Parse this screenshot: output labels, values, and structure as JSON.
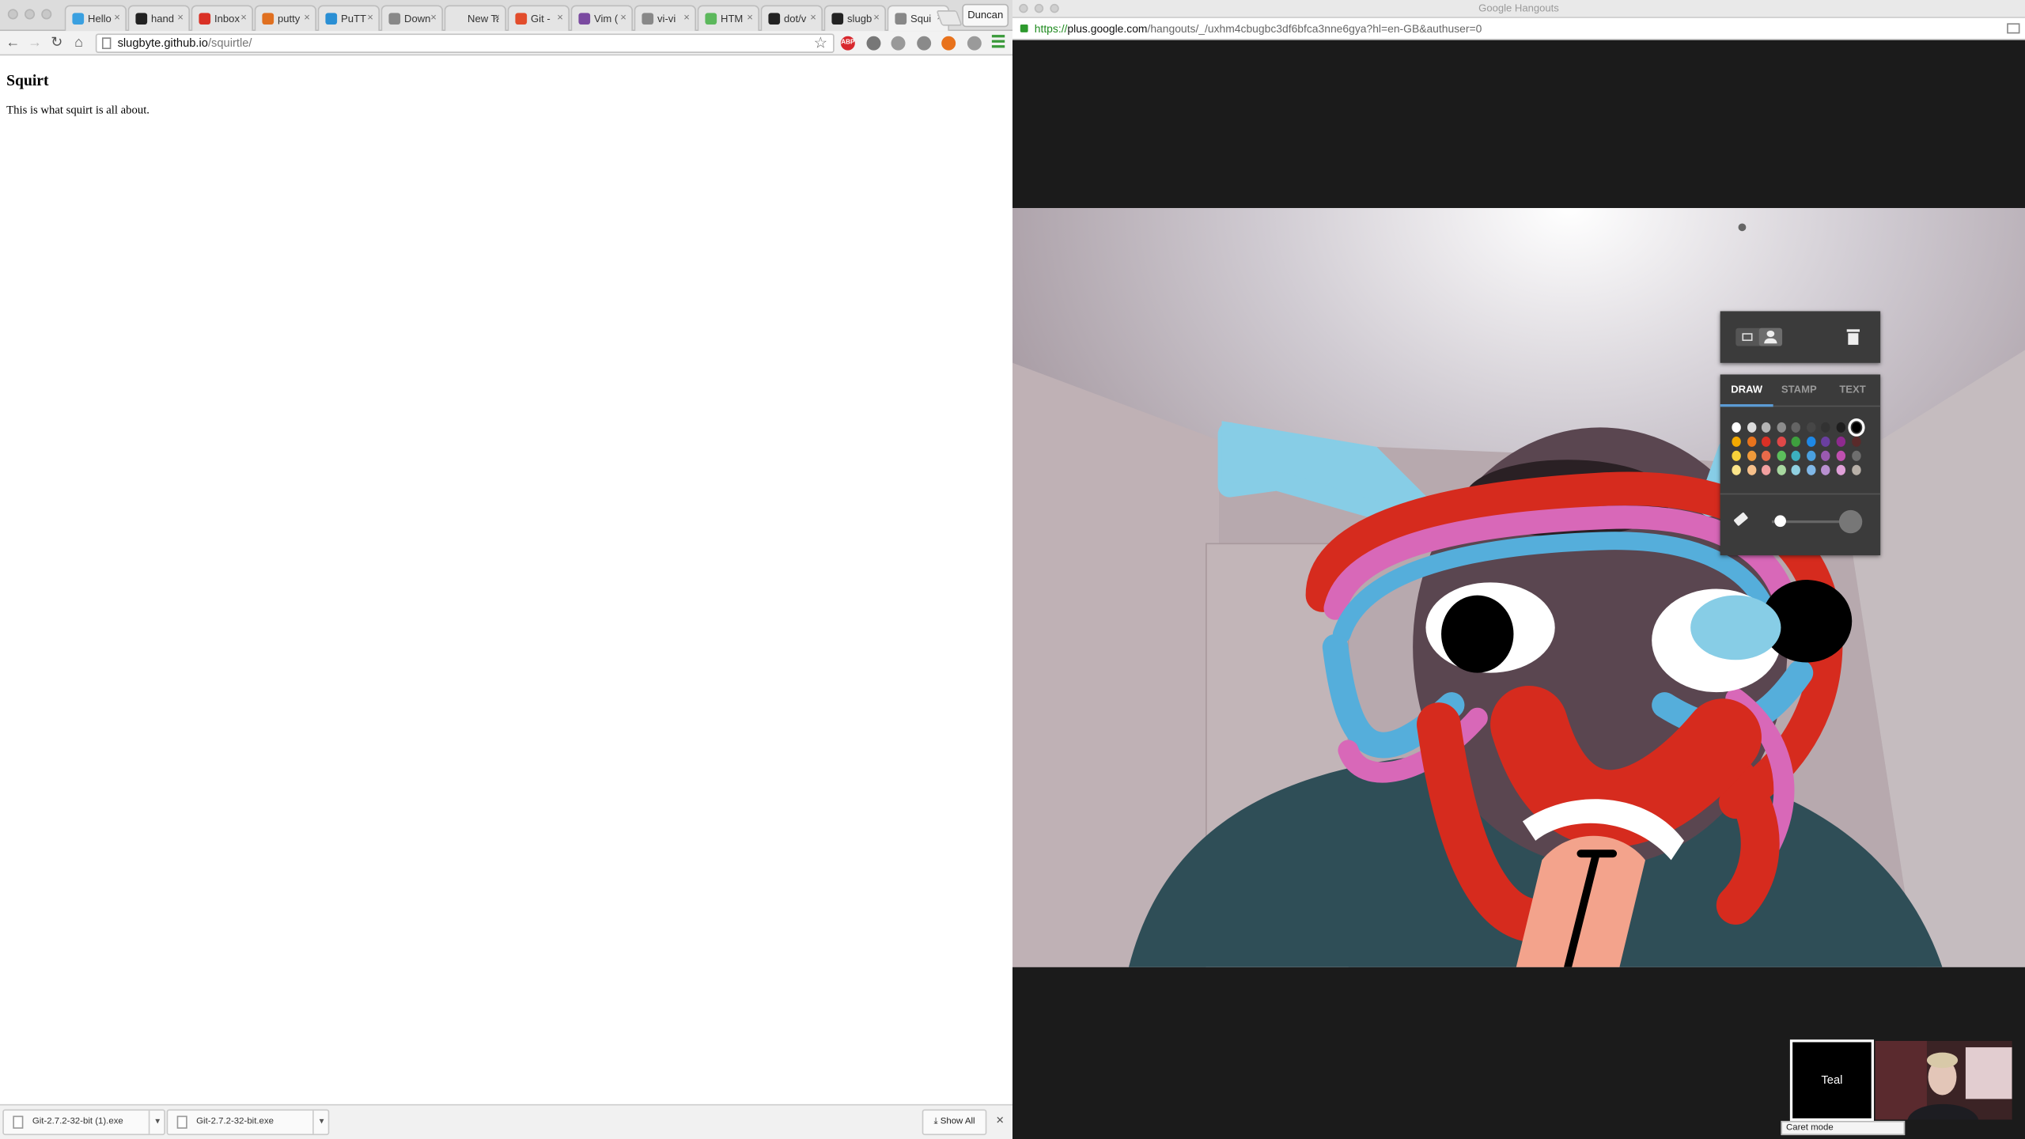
{
  "left_browser": {
    "profile": "Duncan",
    "tabs": [
      {
        "label": "Hello",
        "favicon_color": "#3aa0e0"
      },
      {
        "label": "hand",
        "favicon_color": "#222222"
      },
      {
        "label": "Inbox",
        "favicon_color": "#d93025"
      },
      {
        "label": "putty",
        "favicon_color": "#e07020"
      },
      {
        "label": "PuTT",
        "favicon_color": "#2a8fd4"
      },
      {
        "label": "Down",
        "favicon_color": "#888888"
      },
      {
        "label": "New Ta",
        "favicon_color": ""
      },
      {
        "label": "Git -",
        "favicon_color": "#e24d2c"
      },
      {
        "label": "Vim (",
        "favicon_color": "#7a4aa0"
      },
      {
        "label": "vi-vi",
        "favicon_color": "#888888"
      },
      {
        "label": "HTM",
        "favicon_color": "#5cb85c"
      },
      {
        "label": "dot/v",
        "favicon_color": "#222222"
      },
      {
        "label": "slugb",
        "favicon_color": "#222222"
      },
      {
        "label": "Squi",
        "favicon_color": "#888888",
        "active": true
      }
    ],
    "address": {
      "host": "slugbyte.github.io",
      "path": "/squirtle/"
    },
    "extensions": [
      {
        "name": "adblock-icon",
        "text": "ABP",
        "color": "#d8282e"
      },
      {
        "name": "pocket-icon",
        "text": "",
        "color": "#777777"
      },
      {
        "name": "extension-grey-icon",
        "text": "",
        "color": "#999999"
      },
      {
        "name": "angular-icon",
        "text": "",
        "color": "#8a8a8a"
      },
      {
        "name": "rss-icon",
        "text": "",
        "color": "#e8721c"
      },
      {
        "name": "extension-cube-icon",
        "text": "",
        "color": "#9a9a9a"
      }
    ],
    "page": {
      "heading": "Squirt",
      "body": "This is what squirt is all about."
    },
    "downloads": [
      {
        "file": "Git-2.7.2-32-bit (1).exe"
      },
      {
        "file": "Git-2.7.2-32-bit.exe"
      }
    ],
    "show_all": "Show All"
  },
  "hangouts": {
    "window_title": "Google Hangouts",
    "url": {
      "scheme": "https://",
      "host": "plus.google.com",
      "path": "/hangouts/_/uxhm4cbugbc3df6bfca3nne6gya?hl=en-GB&authuser=0"
    },
    "draw_panel": {
      "tabs": [
        "DRAW",
        "STAMP",
        "TEXT"
      ],
      "selected_tab": "DRAW",
      "palette": [
        [
          "#ffffff",
          "#dcdcdc",
          "#b4b4b4",
          "#8c8c8c",
          "#646464",
          "#464646",
          "#323232",
          "#1e1e1e",
          "#000000"
        ],
        [
          "#f2a900",
          "#e8731c",
          "#d93025",
          "#e04848",
          "#3e9f3e",
          "#1e88e5",
          "#6a3fa0",
          "#8e2a8e",
          "#5a2a2a"
        ],
        [
          "#f7d23a",
          "#f09a3a",
          "#e86a4a",
          "#5cbf5c",
          "#3cb0c0",
          "#4aa0e0",
          "#9a5ab0",
          "#c050b0",
          "#6e6e6e"
        ],
        [
          "#fbe58a",
          "#f7c08a",
          "#f2a0a0",
          "#a8d8a0",
          "#90d0e0",
          "#80b8e8",
          "#b890d0",
          "#e0a0d8",
          "#b8b0a8"
        ]
      ],
      "selected_color": "#000000",
      "brush_size_fraction": 0.1
    },
    "participants": [
      {
        "label": "Teal"
      }
    ],
    "tooltip": "Caret mode"
  }
}
